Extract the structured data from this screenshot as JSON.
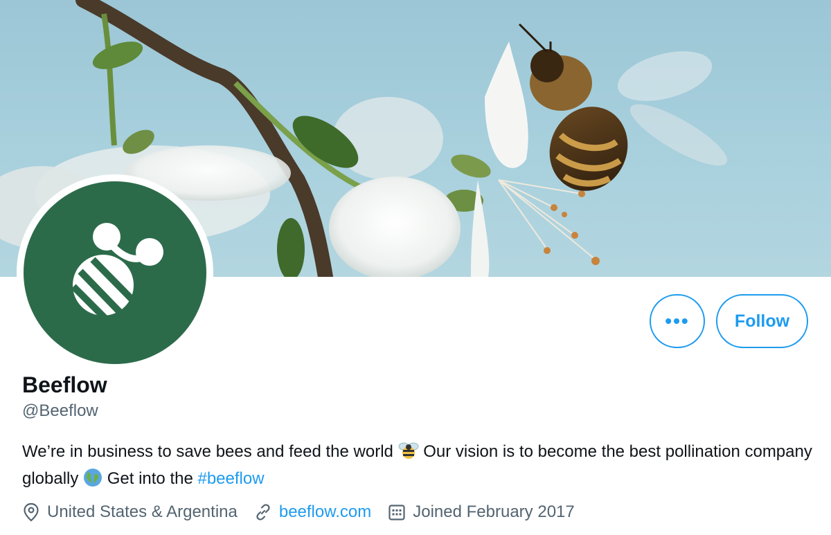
{
  "profile": {
    "name": "Beeflow",
    "handle": "@Beeflow",
    "bio_part1": "We’re in business to save bees and feed the world ",
    "bio_part2": " Our vision is to become the best pollination company globally ",
    "bio_part3": " Get into the ",
    "hashtag": "#beeflow",
    "location": "United States & Argentina",
    "website": "beeflow.com",
    "joined": "Joined February 2017"
  },
  "actions": {
    "more_label": "•••",
    "follow_label": "Follow"
  },
  "colors": {
    "accent": "#1d9bf0",
    "avatar_bg": "#2c6b4a",
    "secondary_text": "#536471"
  },
  "icons": [
    "location-pin-icon",
    "link-icon",
    "calendar-icon",
    "bee-emoji-icon",
    "globe-emoji-icon"
  ]
}
